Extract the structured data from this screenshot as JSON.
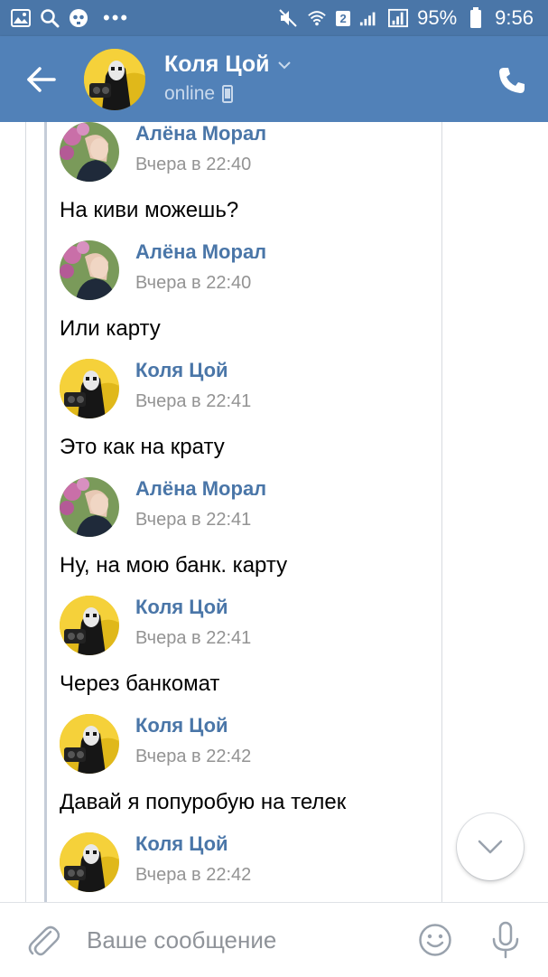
{
  "status_bar": {
    "icons": [
      "gallery-icon",
      "search-icon",
      "skull-icon",
      "more-icon",
      "mute-icon",
      "wifi-icon",
      "sim-badge",
      "signal-icon",
      "signal-icon",
      "battery-icon"
    ],
    "dots": "•••",
    "sim_number": "2",
    "battery": "95%",
    "time": "9:56"
  },
  "header": {
    "contact_name": "Коля Цой",
    "status": "online",
    "icons": [
      "back-arrow-icon",
      "chevron-down-icon",
      "mobile-icon",
      "phone-icon"
    ]
  },
  "messages": [
    {
      "author": "Алёна Морал",
      "time": "Вчера в 22:40",
      "text": "На киви можешь?",
      "avatar": "alena"
    },
    {
      "author": "Алёна Морал",
      "time": "Вчера в 22:40",
      "text": "Или карту",
      "avatar": "alena"
    },
    {
      "author": "Коля Цой",
      "time": "Вчера в 22:41",
      "text": "Это как на крату",
      "avatar": "kolya"
    },
    {
      "author": "Алёна Морал",
      "time": "Вчера в 22:41",
      "text": "Ну, на мою банк. карту",
      "avatar": "alena"
    },
    {
      "author": "Коля Цой",
      "time": "Вчера в 22:41",
      "text": "Через банкомат",
      "avatar": "kolya"
    },
    {
      "author": "Коля Цой",
      "time": "Вчера в 22:42",
      "text": "Давай я попуробую на телек",
      "avatar": "kolya"
    },
    {
      "author": "Коля Цой",
      "time": "Вчера в 22:42",
      "text": "",
      "avatar": "kolya"
    }
  ],
  "input": {
    "placeholder": "Ваше сообщение",
    "value": ""
  },
  "colors": {
    "header_bg": "#5181b8",
    "status_bar_bg": "#4a76a8",
    "author_name": "#4a76a8",
    "timestamp": "#939393",
    "icon_gray": "#99a2ad"
  }
}
